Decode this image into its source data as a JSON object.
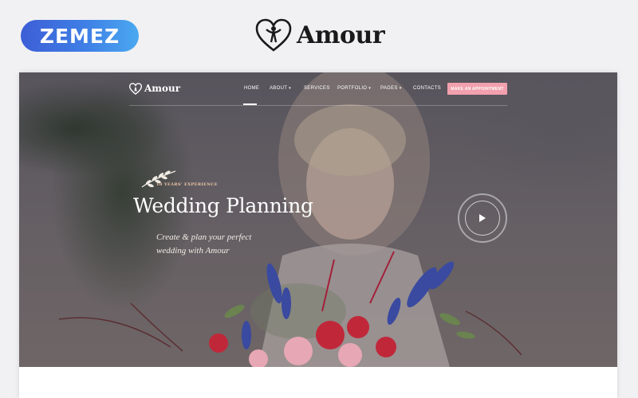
{
  "banner": {
    "vendor_logo_text": "ZEMEZ",
    "brand_name": "Amour",
    "brand_color": "#1a1a1a",
    "vendor_gradient": [
      "#3d5ed6",
      "#4aa9f0"
    ]
  },
  "preview": {
    "nav": {
      "logo_text": "Amour",
      "items": [
        {
          "label": "HOME",
          "active": true
        },
        {
          "label": "ABOUT",
          "dropdown": true
        },
        {
          "label": "SERVICES"
        },
        {
          "label": "PORTFOLIO",
          "dropdown": true
        },
        {
          "label": "PAGES",
          "dropdown": true
        },
        {
          "label": "CONTACTS"
        }
      ],
      "cta_label": "MAKE AN APPOINTMENT",
      "cta_color": "#f2a0ad"
    },
    "hero": {
      "badge": "10 YEARS' EXPERIENCE",
      "title": "Wedding Planning",
      "subtitle_line1": "Create & plan your perfect",
      "subtitle_line2": "wedding with Amour",
      "play_icon": "play-icon"
    }
  }
}
